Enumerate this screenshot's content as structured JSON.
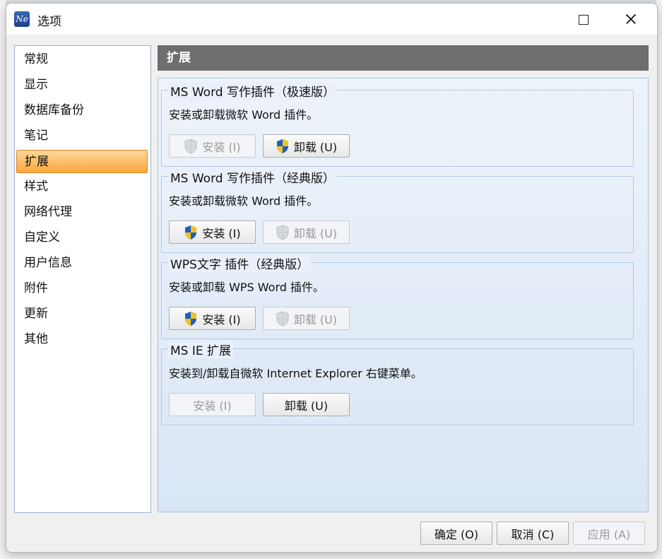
{
  "window": {
    "title": "选项",
    "app_icon_text": "Ne"
  },
  "nav": {
    "items": [
      {
        "label": "常规"
      },
      {
        "label": "显示"
      },
      {
        "label": "数据库备份"
      },
      {
        "label": "笔记"
      },
      {
        "label": "扩展",
        "selected": true
      },
      {
        "label": "样式"
      },
      {
        "label": "网络代理"
      },
      {
        "label": "自定义"
      },
      {
        "label": "用户信息"
      },
      {
        "label": "附件"
      },
      {
        "label": "更新"
      },
      {
        "label": "其他"
      }
    ]
  },
  "panel": {
    "header": "扩展",
    "groups": [
      {
        "title": "MS Word 写作插件（极速版）",
        "description": "安装或卸载微软 Word 插件。",
        "install": {
          "label": "安装 (I)",
          "enabled": false,
          "icon": "uac-shield-icon"
        },
        "uninstall": {
          "label": "卸载 (U)",
          "enabled": true,
          "icon": "uac-shield-icon"
        }
      },
      {
        "title": "MS Word 写作插件（经典版）",
        "description": "安装或卸载微软 Word 插件。",
        "install": {
          "label": "安装 (I)",
          "enabled": true,
          "icon": "uac-shield-icon"
        },
        "uninstall": {
          "label": "卸载 (U)",
          "enabled": false,
          "icon": "uac-shield-icon"
        }
      },
      {
        "title": "WPS文字 插件（经典版）",
        "description": "安装或卸载 WPS Word 插件。",
        "install": {
          "label": "安装 (I)",
          "enabled": true,
          "icon": "uac-shield-icon"
        },
        "uninstall": {
          "label": "卸载 (U)",
          "enabled": false,
          "icon": "uac-shield-icon"
        }
      },
      {
        "title": "MS IE 扩展",
        "description": "安装到/卸载自微软 Internet Explorer 右键菜单。",
        "install": {
          "label": "安装 (I)",
          "enabled": false
        },
        "uninstall": {
          "label": "卸载 (U)",
          "enabled": true
        }
      }
    ]
  },
  "footer": {
    "ok": "确定 (O)",
    "cancel": "取消 (C)",
    "apply": "应用 (A)"
  },
  "colors": {
    "selected_nav": "#f9a73d",
    "header_bg": "#6e6e6e",
    "panel_bg": "#e4edf8"
  }
}
